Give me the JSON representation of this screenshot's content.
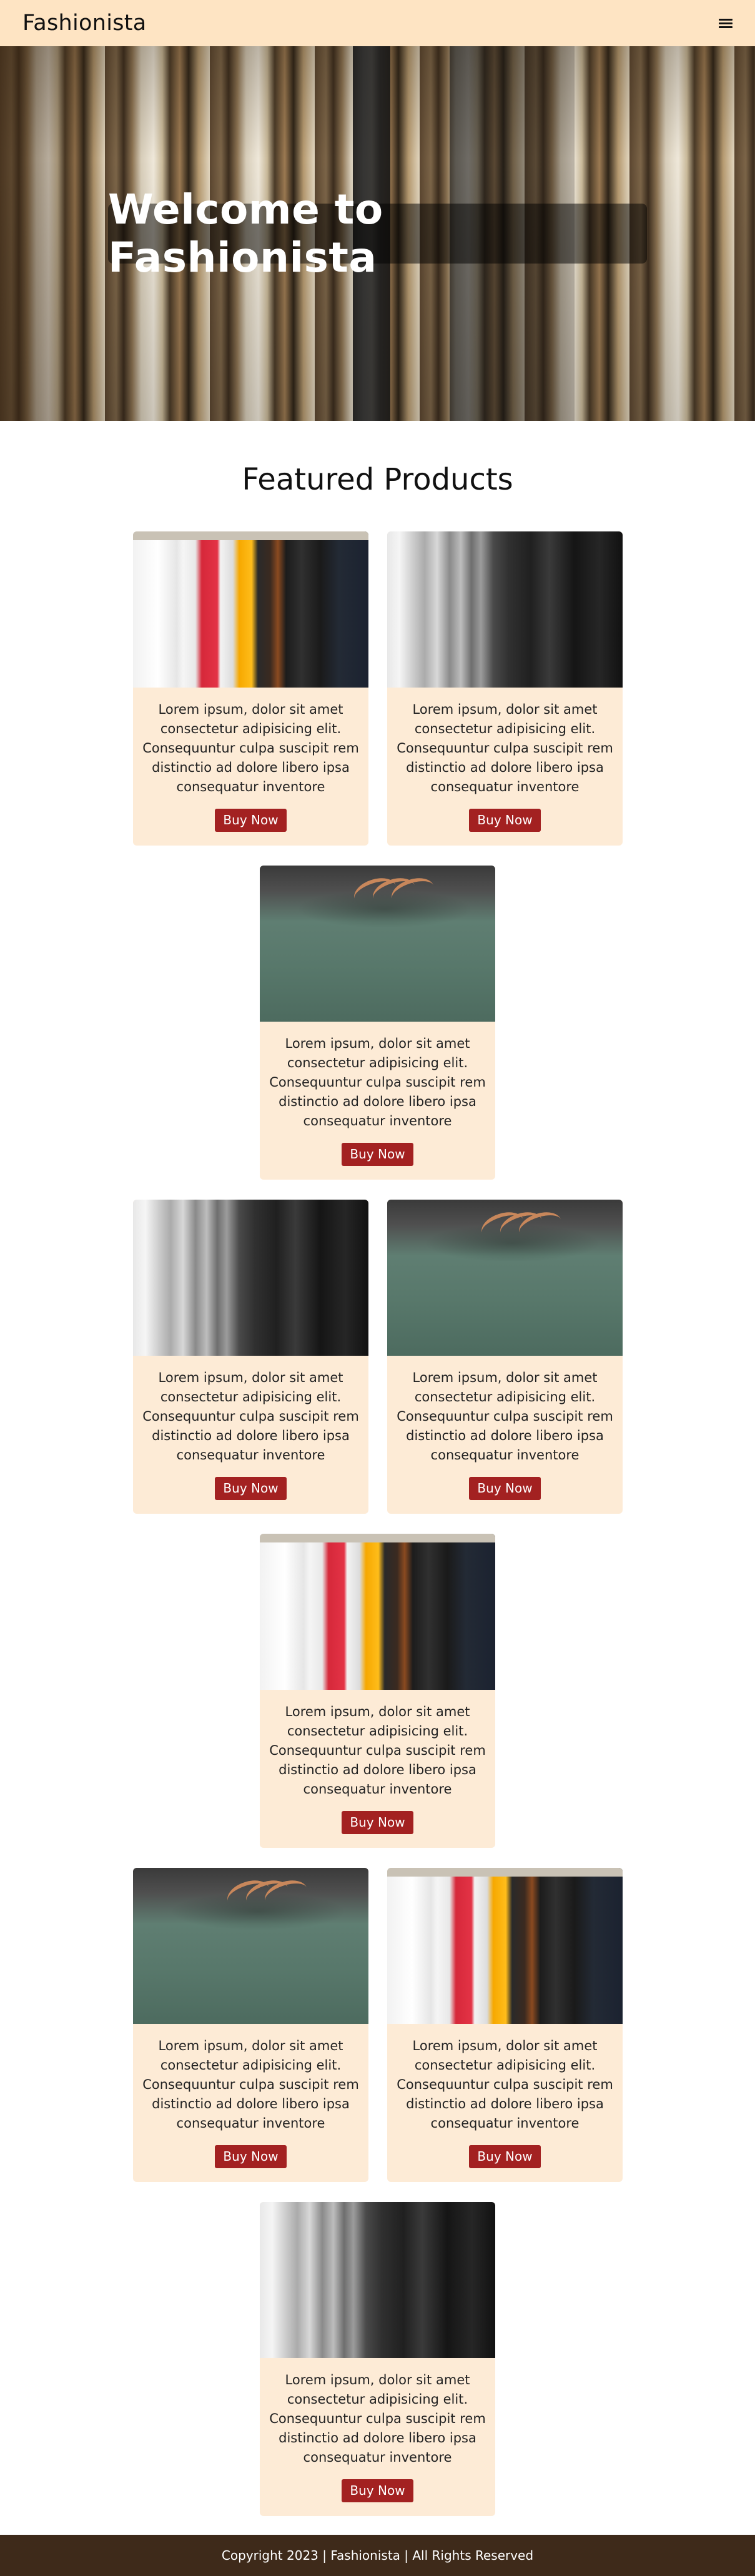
{
  "header": {
    "brand": "Fashionista",
    "menu_icon": "hamburger-menu-icon"
  },
  "hero": {
    "title": "Welcome to Fashionista"
  },
  "featured": {
    "title": "Featured Products",
    "products": [
      {
        "image": "colorful-tshirts-on-rack",
        "description": "Lorem ipsum, dolor sit amet consectetur adipisicing elit. Consequuntur culpa suscipit rem distinctio ad dolore libero ipsa consequatur inventore",
        "button": "Buy Now"
      },
      {
        "image": "grayscale-tshirts-on-rack",
        "description": "Lorem ipsum, dolor sit amet consectetur adipisicing elit. Consequuntur culpa suscipit rem distinctio ad dolore libero ipsa consequatur inventore",
        "button": "Buy Now"
      },
      {
        "image": "green-tshirts-on-hangers",
        "description": "Lorem ipsum, dolor sit amet consectetur adipisicing elit. Consequuntur culpa suscipit rem distinctio ad dolore libero ipsa consequatur inventore",
        "button": "Buy Now"
      },
      {
        "image": "grayscale-tshirts-on-rack",
        "description": "Lorem ipsum, dolor sit amet consectetur adipisicing elit. Consequuntur culpa suscipit rem distinctio ad dolore libero ipsa consequatur inventore",
        "button": "Buy Now"
      },
      {
        "image": "green-tshirts-on-hangers",
        "description": "Lorem ipsum, dolor sit amet consectetur adipisicing elit. Consequuntur culpa suscipit rem distinctio ad dolore libero ipsa consequatur inventore",
        "button": "Buy Now"
      },
      {
        "image": "colorful-tshirts-on-rack",
        "description": "Lorem ipsum, dolor sit amet consectetur adipisicing elit. Consequuntur culpa suscipit rem distinctio ad dolore libero ipsa consequatur inventore",
        "button": "Buy Now"
      },
      {
        "image": "green-tshirts-on-hangers",
        "description": "Lorem ipsum, dolor sit amet consectetur adipisicing elit. Consequuntur culpa suscipit rem distinctio ad dolore libero ipsa consequatur inventore",
        "button": "Buy Now"
      },
      {
        "image": "colorful-tshirts-on-rack",
        "description": "Lorem ipsum, dolor sit amet consectetur adipisicing elit. Consequuntur culpa suscipit rem distinctio ad dolore libero ipsa consequatur inventore",
        "button": "Buy Now"
      },
      {
        "image": "grayscale-tshirts-on-rack",
        "description": "Lorem ipsum, dolor sit amet consectetur adipisicing elit. Consequuntur culpa suscipit rem distinctio ad dolore libero ipsa consequatur inventore",
        "button": "Buy Now"
      }
    ]
  },
  "footer": {
    "text": "Copyright 2023 | Fashionista | All Rights Reserved"
  },
  "colors": {
    "header_bg": "#fee4c3",
    "card_bg": "#fdebd6",
    "button_bg": "#a32121",
    "footer_bg": "#3e2a1a"
  }
}
